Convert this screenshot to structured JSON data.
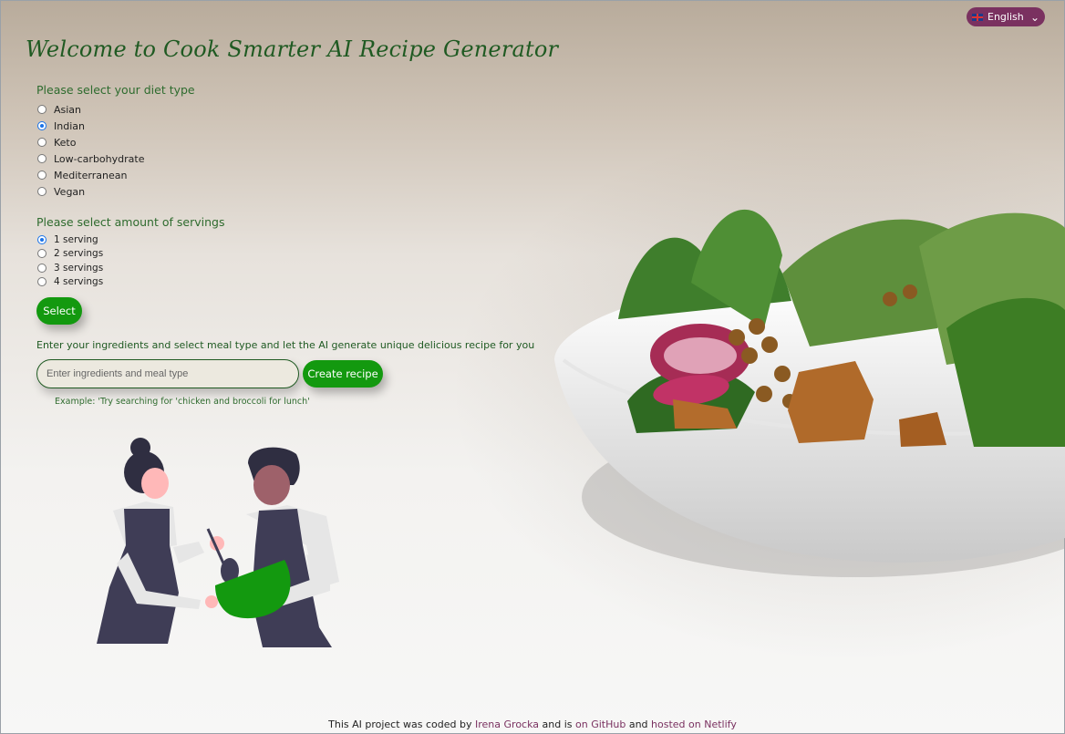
{
  "language": {
    "selected": "English"
  },
  "title": "Welcome to Cook Smarter AI Recipe Generator",
  "diet": {
    "label": "Please select your diet type",
    "options": [
      "Asian",
      "Indian",
      "Keto",
      "Low-carbohydrate",
      "Mediterranean",
      "Vegan"
    ],
    "selected": "Indian"
  },
  "servings": {
    "label": "Please select amount of servings",
    "options": [
      "1 serving",
      "2 servings",
      "3 servings",
      "4 servings"
    ],
    "selected": "1 serving"
  },
  "select_button": "Select",
  "prompt_text": "Enter your ingredients and select meal type and let the AI generate unique delicious recipe for you",
  "search": {
    "placeholder": "Enter ingredients and meal type",
    "value": ""
  },
  "create_button": "Create recipe",
  "example_text": "Example: 'Try searching for 'chicken and broccoli for lunch'",
  "footer": {
    "before": "This AI project was coded by",
    "author": "Irena Grocka",
    "middle1": "and is",
    "github": "on GitHub",
    "middle2": "and",
    "netlify": "hosted on Netlify"
  },
  "colors": {
    "accent_green": "#13990f",
    "heading_green": "#1f5a22",
    "plum": "#7a3160"
  },
  "icons": {
    "flag": "uk-flag-icon",
    "chevron": "chevron-down-icon"
  }
}
